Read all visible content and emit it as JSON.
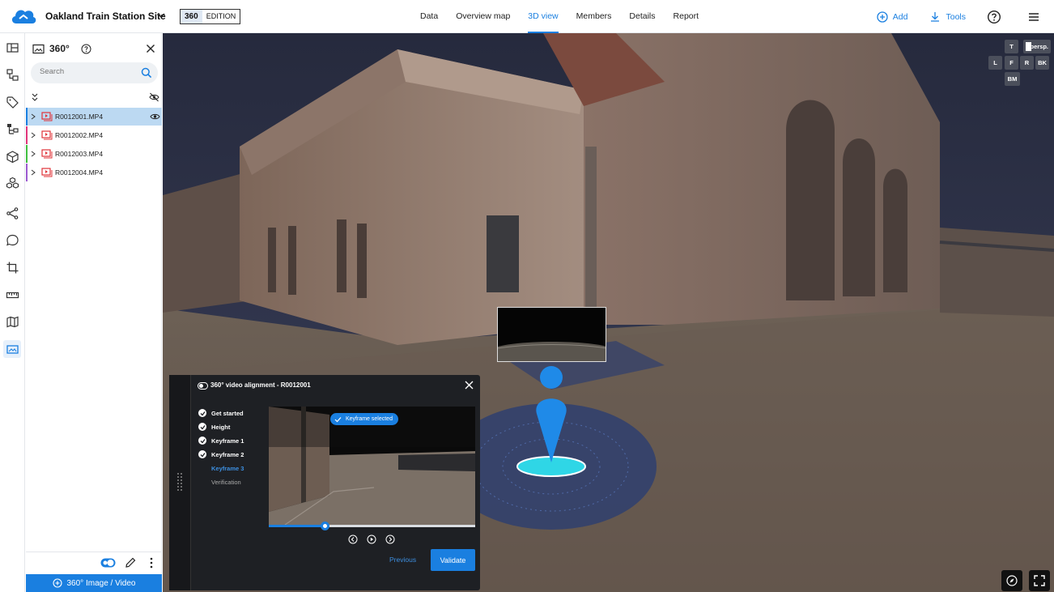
{
  "header": {
    "project_title": "Oakland Train Station Site",
    "edition_tag": "360",
    "edition_label": "EDITION",
    "nav": [
      {
        "label": "Data",
        "active": false
      },
      {
        "label": "Overview map",
        "active": false
      },
      {
        "label": "3D view",
        "active": true
      },
      {
        "label": "Members",
        "active": false
      },
      {
        "label": "Details",
        "active": false
      },
      {
        "label": "Report",
        "active": false
      }
    ],
    "add_label": "Add",
    "tools_label": "Tools",
    "accent": "#1a7fe0"
  },
  "rail": {
    "items": [
      "layers-icon",
      "tree-icon",
      "tag-icon",
      "hierarchy-icon",
      "cube-icon",
      "cubes-icon",
      "share-icon",
      "comment-icon",
      "crop-icon",
      "ruler-icon",
      "map-icon",
      "panorama-icon"
    ],
    "active": "panorama-icon"
  },
  "panel": {
    "title": "360°",
    "search_placeholder": "Search",
    "files": [
      {
        "name": "R0012001.MP4",
        "selected": true,
        "color": "#1a7fe0"
      },
      {
        "name": "R0012002.MP4",
        "selected": false,
        "color": "#e0347a"
      },
      {
        "name": "R0012003.MP4",
        "selected": false,
        "color": "#3fbf3f"
      },
      {
        "name": "R0012004.MP4",
        "selected": false,
        "color": "#9b59d0"
      }
    ],
    "add_button": "360° Image / Video"
  },
  "viewer": {
    "view_buttons": [
      "T",
      "L",
      "F",
      "R",
      "BK",
      "BM"
    ],
    "persp_label": "persp."
  },
  "dialog": {
    "title": "360° video alignment - R0012001",
    "steps": [
      {
        "label": "Get started",
        "state": "done"
      },
      {
        "label": "Height",
        "state": "done"
      },
      {
        "label": "Keyframe 1",
        "state": "done"
      },
      {
        "label": "Keyframe 2",
        "state": "done"
      },
      {
        "label": "Keyframe 3",
        "state": "current"
      },
      {
        "label": "Verification",
        "state": "pending"
      }
    ],
    "keyframe_badge": "Keyframe selected",
    "playback_progress": 0.27,
    "previous_label": "Previous",
    "validate_label": "Validate"
  }
}
